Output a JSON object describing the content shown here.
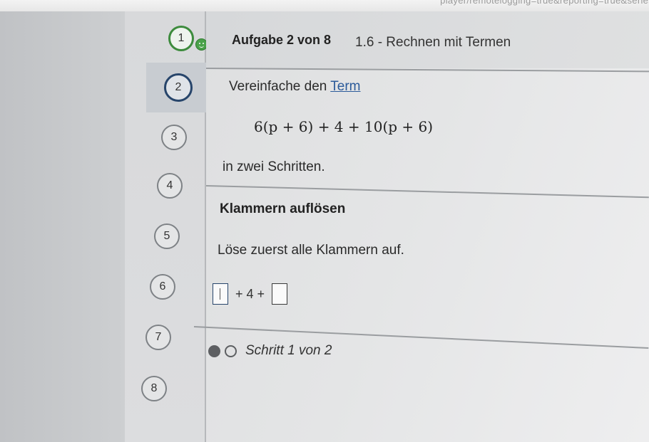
{
  "browser": {
    "url_fragment": "player/remotelogging=true&reporting=true&series"
  },
  "sidebar": {
    "steps": [
      {
        "number": "1",
        "state": "done"
      },
      {
        "number": "2",
        "state": "current"
      },
      {
        "number": "3",
        "state": "open"
      },
      {
        "number": "4",
        "state": "open"
      },
      {
        "number": "5",
        "state": "open"
      },
      {
        "number": "6",
        "state": "open"
      },
      {
        "number": "7",
        "state": "open"
      },
      {
        "number": "8",
        "state": "open"
      }
    ]
  },
  "header": {
    "title": "Aufgabe 2 von 8",
    "subtitle": "1.6 - Rechnen mit Termen"
  },
  "task": {
    "intro_prefix": "Vereinfache den",
    "intro_link": "Term",
    "formula": "6(p + 6) + 4 + 10(p + 6)",
    "outro": "in zwei Schritten."
  },
  "step": {
    "heading": "Klammern auflösen",
    "instruction": "Löse zuerst alle Klammern auf.",
    "answer": {
      "box1_value": "",
      "middle_text": "+ 4 +",
      "box2_value": ""
    }
  },
  "progress": {
    "label": "Schritt 1 von 2",
    "current": 1,
    "total": 2
  },
  "colors": {
    "done_ring": "#3d8b3d",
    "current_ring": "#27456b",
    "link": "#2b5a9a"
  }
}
